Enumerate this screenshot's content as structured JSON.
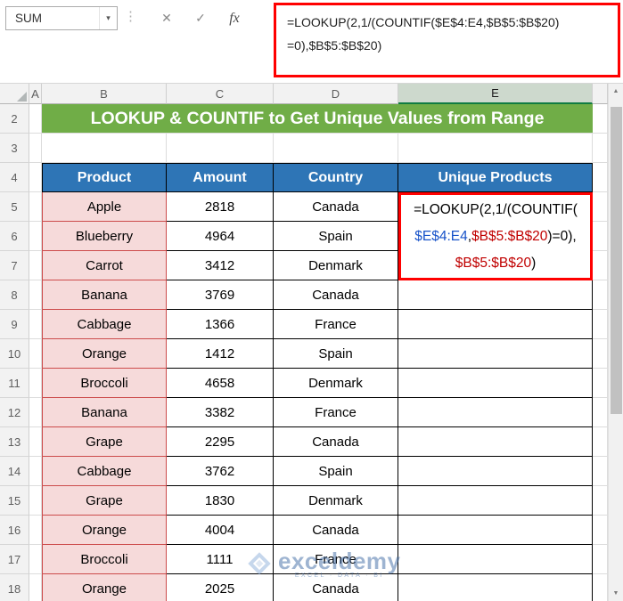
{
  "formula_bar": {
    "name_box_value": "SUM",
    "name_box_dropdown_icon": "▾",
    "separator_dots_icon": "⋮",
    "cancel_icon": "✕",
    "enter_icon": "✓",
    "insert_function_label": "fx",
    "formula_lines": [
      "=LOOKUP(2,1/(COUNTIF($E$4:E4,$B$5:$B$20)",
      "=0),$B$5:$B$20)"
    ]
  },
  "banner": {
    "title": "LOOKUP & COUNTIF to Get Unique Values from Range",
    "bg": "#70AD47"
  },
  "grid": {
    "columns": [
      "A",
      "B",
      "C",
      "D",
      "E"
    ],
    "selected_column": "E",
    "rows": [
      "2",
      "3",
      "4",
      "5",
      "6",
      "7",
      "8",
      "9",
      "10",
      "11",
      "12",
      "13",
      "14",
      "15",
      "16",
      "17",
      "18"
    ]
  },
  "table": {
    "headers": [
      "Product",
      "Amount",
      "Country",
      "Unique Products"
    ],
    "header_bg": "#2E75B6",
    "product_cell_bg": "#F6DADA",
    "product_border": "#CC4B4B",
    "rows": [
      [
        "Apple",
        "2818",
        "Canada"
      ],
      [
        "Blueberry",
        "4964",
        "Spain"
      ],
      [
        "Carrot",
        "3412",
        "Denmark"
      ],
      [
        "Banana",
        "3769",
        "Canada"
      ],
      [
        "Cabbage",
        "1366",
        "France"
      ],
      [
        "Orange",
        "1412",
        "Spain"
      ],
      [
        "Broccoli",
        "4658",
        "Denmark"
      ],
      [
        "Banana",
        "3382",
        "France"
      ],
      [
        "Grape",
        "2295",
        "Canada"
      ],
      [
        "Cabbage",
        "3762",
        "Spain"
      ],
      [
        "Grape",
        "1830",
        "Denmark"
      ],
      [
        "Orange",
        "4004",
        "Canada"
      ],
      [
        "Broccoli",
        "1111",
        "France"
      ],
      [
        "Orange",
        "2025",
        "Canada"
      ]
    ]
  },
  "active_cell": {
    "address": "E5",
    "formula_lines": [
      [
        {
          "t": "=LOOKUP(2,1/(COUNTIF(",
          "c": "#000000"
        }
      ],
      [
        {
          "t": "$E$4:E4",
          "c": "#1853C9"
        },
        {
          "t": ",",
          "c": "#000000"
        },
        {
          "t": "$B$5:$B$20",
          "c": "#C00000"
        },
        {
          "t": ")=0),",
          "c": "#000000"
        }
      ],
      [
        {
          "t": "$B$5:$B$20",
          "c": "#C00000"
        },
        {
          "t": ")",
          "c": "#000000"
        }
      ]
    ]
  },
  "scrollbar": {
    "up_icon": "▲",
    "down_icon": "▼"
  },
  "watermark": {
    "brand": "exceldemy",
    "tagline": "EXCEL · DATA · BI"
  },
  "colors": {
    "highlight_border": "#FF0000",
    "selected_header_bg": "#CDD9CD",
    "selected_header_accent": "#107C41"
  }
}
